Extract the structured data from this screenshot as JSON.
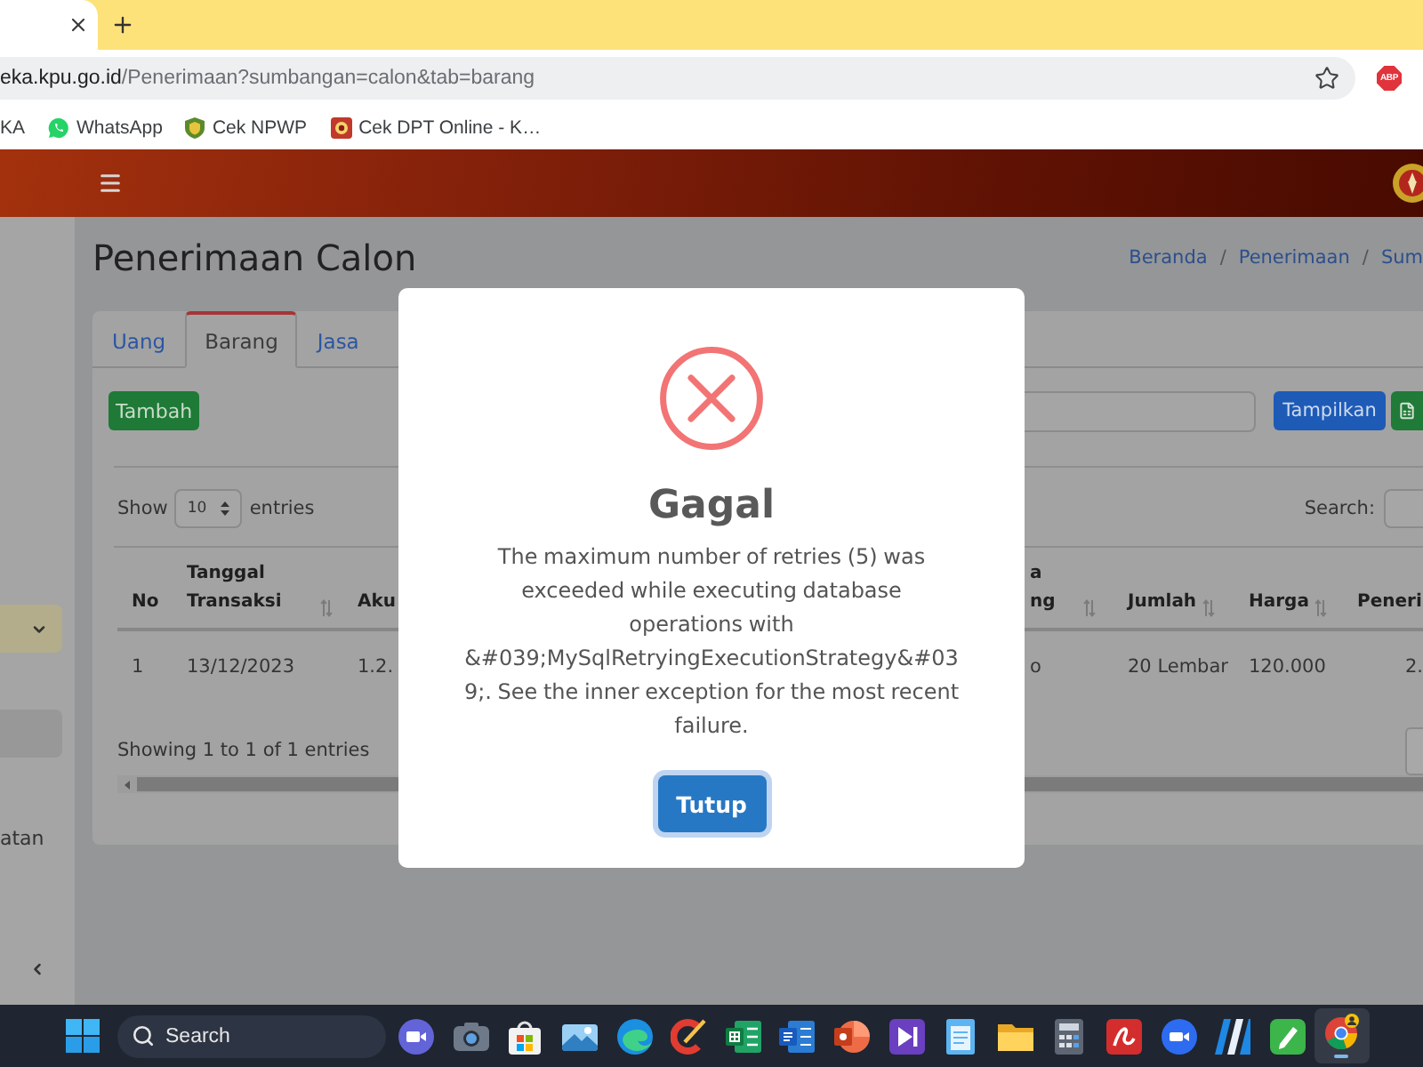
{
  "browser": {
    "url_host": "eka.kpu.go.id",
    "url_path": "/Penerimaan?sumbangan=calon&tab=barang",
    "extension_badge": "ABP"
  },
  "bookmarks": [
    {
      "kind": "plain",
      "label": "KA"
    },
    {
      "kind": "chat",
      "label": "WhatsApp"
    },
    {
      "kind": "shield",
      "label": "Cek NPWP"
    },
    {
      "kind": "seal",
      "label": "Cek DPT Online - K…"
    }
  ],
  "sidebar": {
    "items": [
      {
        "kind": "group",
        "expanded": true,
        "selected": false
      },
      {
        "kind": "link",
        "selected": true
      },
      {
        "kind": "link",
        "label": "atan",
        "selected": false
      }
    ]
  },
  "page": {
    "title": "Penerimaan Calon",
    "breadcrumb": [
      "Beranda",
      "Penerimaan",
      "Sum"
    ],
    "breadcrumb_separator": "/"
  },
  "tabs": [
    {
      "label": "Uang",
      "selected": false
    },
    {
      "label": "Barang",
      "selected": true
    },
    {
      "label": "Jasa",
      "selected": false
    }
  ],
  "toolbar": {
    "add_button": "Tambah",
    "show_button": "Tampilkan"
  },
  "table_controls": {
    "show_label": "Show",
    "page_size": "10",
    "entries_label": "entries",
    "search_label": "Search:"
  },
  "table": {
    "columns": [
      {
        "lines": [
          "No"
        ],
        "sortable": false
      },
      {
        "lines": [
          "Tanggal",
          "Transaksi"
        ],
        "sortable": true
      },
      {
        "lines": [
          "Aku"
        ],
        "sortable": false
      },
      {
        "lines": [
          "a",
          "ng"
        ],
        "sortable": true
      },
      {
        "lines": [
          "Jumlah"
        ],
        "sortable": true
      },
      {
        "lines": [
          "Harga"
        ],
        "sortable": true
      },
      {
        "lines": [
          "Peneri"
        ],
        "sortable": false
      }
    ],
    "rows": [
      [
        "1",
        "13/12/2023",
        "1.2.",
        "o",
        "20 Lembar",
        "120.000",
        "2."
      ]
    ],
    "info": "Showing 1 to 1 of 1 entries"
  },
  "dialog": {
    "kind": "error",
    "title": "Gagal",
    "message": "The maximum number of retries (5) was exceeded while executing database operations with &#039;MySqlRetryingExecutionStrategy&#039;. See the inner exception for the most recent failure.",
    "button": "Tutup"
  },
  "taskbar": {
    "search_label": "Search",
    "apps": [
      {
        "kind": "videocall",
        "active": false
      },
      {
        "kind": "camera",
        "active": false
      },
      {
        "kind": "store",
        "active": false
      },
      {
        "kind": "photos",
        "active": false
      },
      {
        "kind": "swirl",
        "active": false
      },
      {
        "kind": "cleaner",
        "active": false
      },
      {
        "kind": "spreadsheet",
        "active": false
      },
      {
        "kind": "document",
        "active": false
      },
      {
        "kind": "presentation",
        "active": false
      },
      {
        "kind": "media",
        "active": false
      },
      {
        "kind": "notepad",
        "active": false
      },
      {
        "kind": "folder",
        "active": false
      },
      {
        "kind": "calculator",
        "active": false
      },
      {
        "kind": "reader",
        "active": false
      },
      {
        "kind": "meeting",
        "active": false
      },
      {
        "kind": "stripes",
        "active": false
      },
      {
        "kind": "pen",
        "active": false
      },
      {
        "kind": "browser",
        "active": true
      }
    ]
  }
}
